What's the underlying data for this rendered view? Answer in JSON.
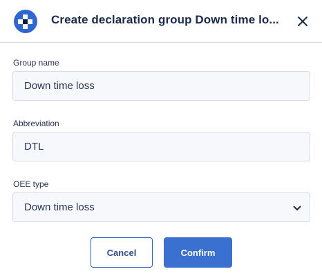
{
  "dialog": {
    "title": "Create declaration group Down time lo...",
    "logo_icon": "checkered-logo-icon",
    "close_icon": "close-icon"
  },
  "form": {
    "group_name": {
      "label": "Group name",
      "value": "Down time loss"
    },
    "abbreviation": {
      "label": "Abbreviation",
      "value": "DTL"
    },
    "oee_type": {
      "label": "OEE type",
      "selected": "Down time loss",
      "icon": "chevron-down-icon"
    }
  },
  "actions": {
    "cancel_label": "Cancel",
    "confirm_label": "Confirm"
  },
  "colors": {
    "accent": "#3a70cf",
    "title_text": "#1c2a4a",
    "field_bg": "#f6f8fc",
    "field_border": "#d6dceb"
  }
}
